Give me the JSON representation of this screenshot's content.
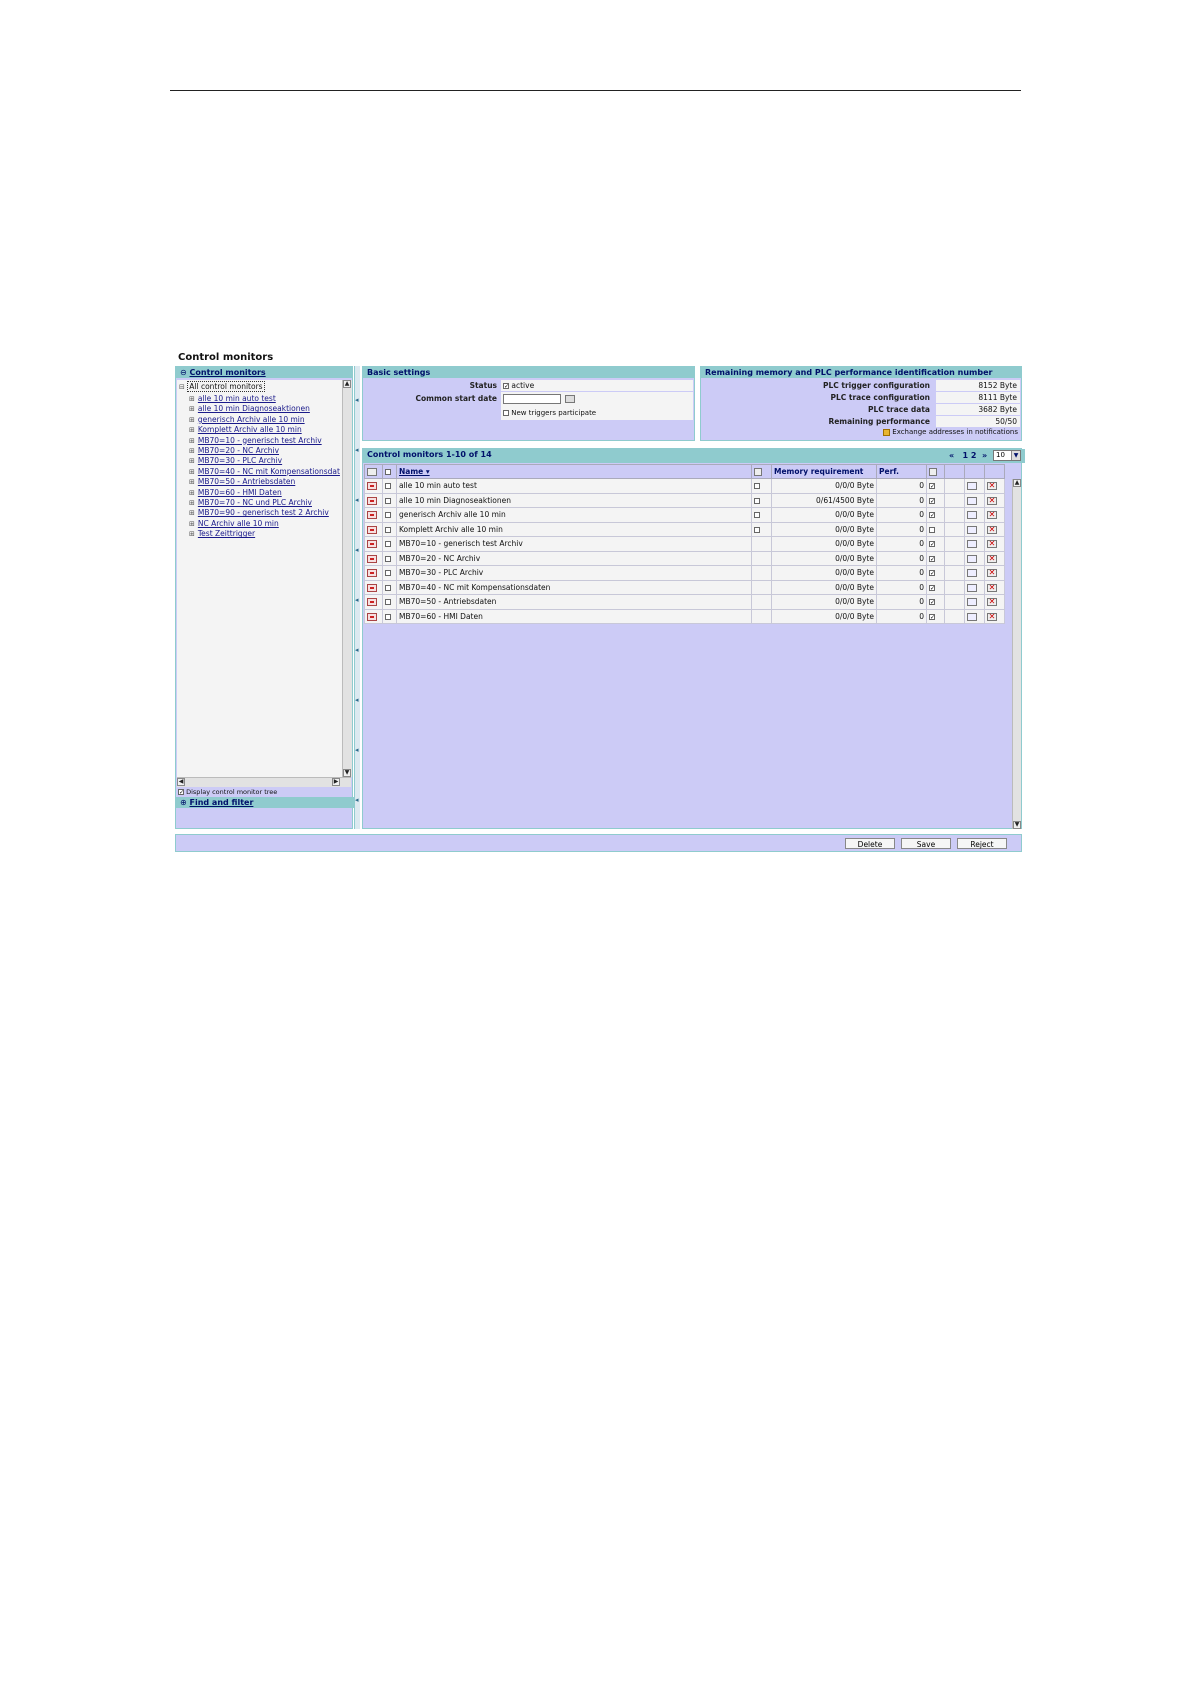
{
  "page": {
    "title": "Control monitors"
  },
  "left": {
    "header": "Control monitors",
    "root": "All control monitors",
    "items": [
      "alle 10 min auto test",
      "alle 10 min Diagnoseaktionen",
      "generisch Archiv alle 10 min",
      "Komplett Archiv alle 10 min",
      "MB70=10 - generisch test Archiv",
      "MB70=20 - NC Archiv",
      "MB70=30 - PLC Archiv",
      "MB70=40 - NC mit Kompensationsdat",
      "MB70=50 - Antriebsdaten",
      "MB70=60 - HMI Daten",
      "MB70=70 - NC und PLC Archiv",
      "MB70=90 - generisch test 2 Archiv",
      "NC Archiv alle 10 min",
      "Test Zeittrigger"
    ],
    "display_tree_label": "Display control monitor tree",
    "find_header": "Find and filter"
  },
  "settings": {
    "header": "Basic settings",
    "status_label": "Status",
    "status_value": "active",
    "start_date_label": "Common start date",
    "start_date_value": "",
    "new_triggers_label": "New triggers participate"
  },
  "memory": {
    "header": "Remaining memory and PLC performance identification number",
    "rows": [
      {
        "label": "PLC trigger configuration",
        "value": "8152 Byte"
      },
      {
        "label": "PLC trace configuration",
        "value": "8111 Byte"
      },
      {
        "label": "PLC trace data",
        "value": "3682 Byte"
      },
      {
        "label": "Remaining performance",
        "value": "50/50"
      }
    ],
    "exchange_label": "Exchange addresses in notifications"
  },
  "list": {
    "header": "Control monitors 1-10 of 14",
    "pages": [
      "1",
      "2"
    ],
    "page_size": "10",
    "columns": {
      "name": "Name ▾",
      "memory": "Memory requirement",
      "perf": "Perf."
    },
    "rows": [
      {
        "name": "alle 10 min auto test",
        "memory": "0/0/0 Byte",
        "perf": "0"
      },
      {
        "name": "alle 10 min Diagnoseaktionen",
        "memory": "0/61/4500 Byte",
        "perf": "0"
      },
      {
        "name": "generisch Archiv alle 10 min",
        "memory": "0/0/0 Byte",
        "perf": "0"
      },
      {
        "name": "Komplett Archiv alle 10 min",
        "memory": "0/0/0 Byte",
        "perf": "0"
      },
      {
        "name": "MB70=10 - generisch test Archiv",
        "memory": "0/0/0 Byte",
        "perf": "0"
      },
      {
        "name": "MB70=20 - NC Archiv",
        "memory": "0/0/0 Byte",
        "perf": "0"
      },
      {
        "name": "MB70=30 - PLC Archiv",
        "memory": "0/0/0 Byte",
        "perf": "0"
      },
      {
        "name": "MB70=40 - NC mit Kompensationsdaten",
        "memory": "0/0/0 Byte",
        "perf": "0"
      },
      {
        "name": "MB70=50 - Antriebsdaten",
        "memory": "0/0/0 Byte",
        "perf": "0"
      },
      {
        "name": "MB70=60 - HMI Daten",
        "memory": "0/0/0 Byte",
        "perf": "0"
      }
    ]
  },
  "buttons": {
    "delete": "Delete",
    "save": "Save",
    "reject": "Reject"
  },
  "colors": {
    "panel_header": "#8fcbce",
    "panel_body": "#cccbf6",
    "header_text": "#00106a"
  }
}
